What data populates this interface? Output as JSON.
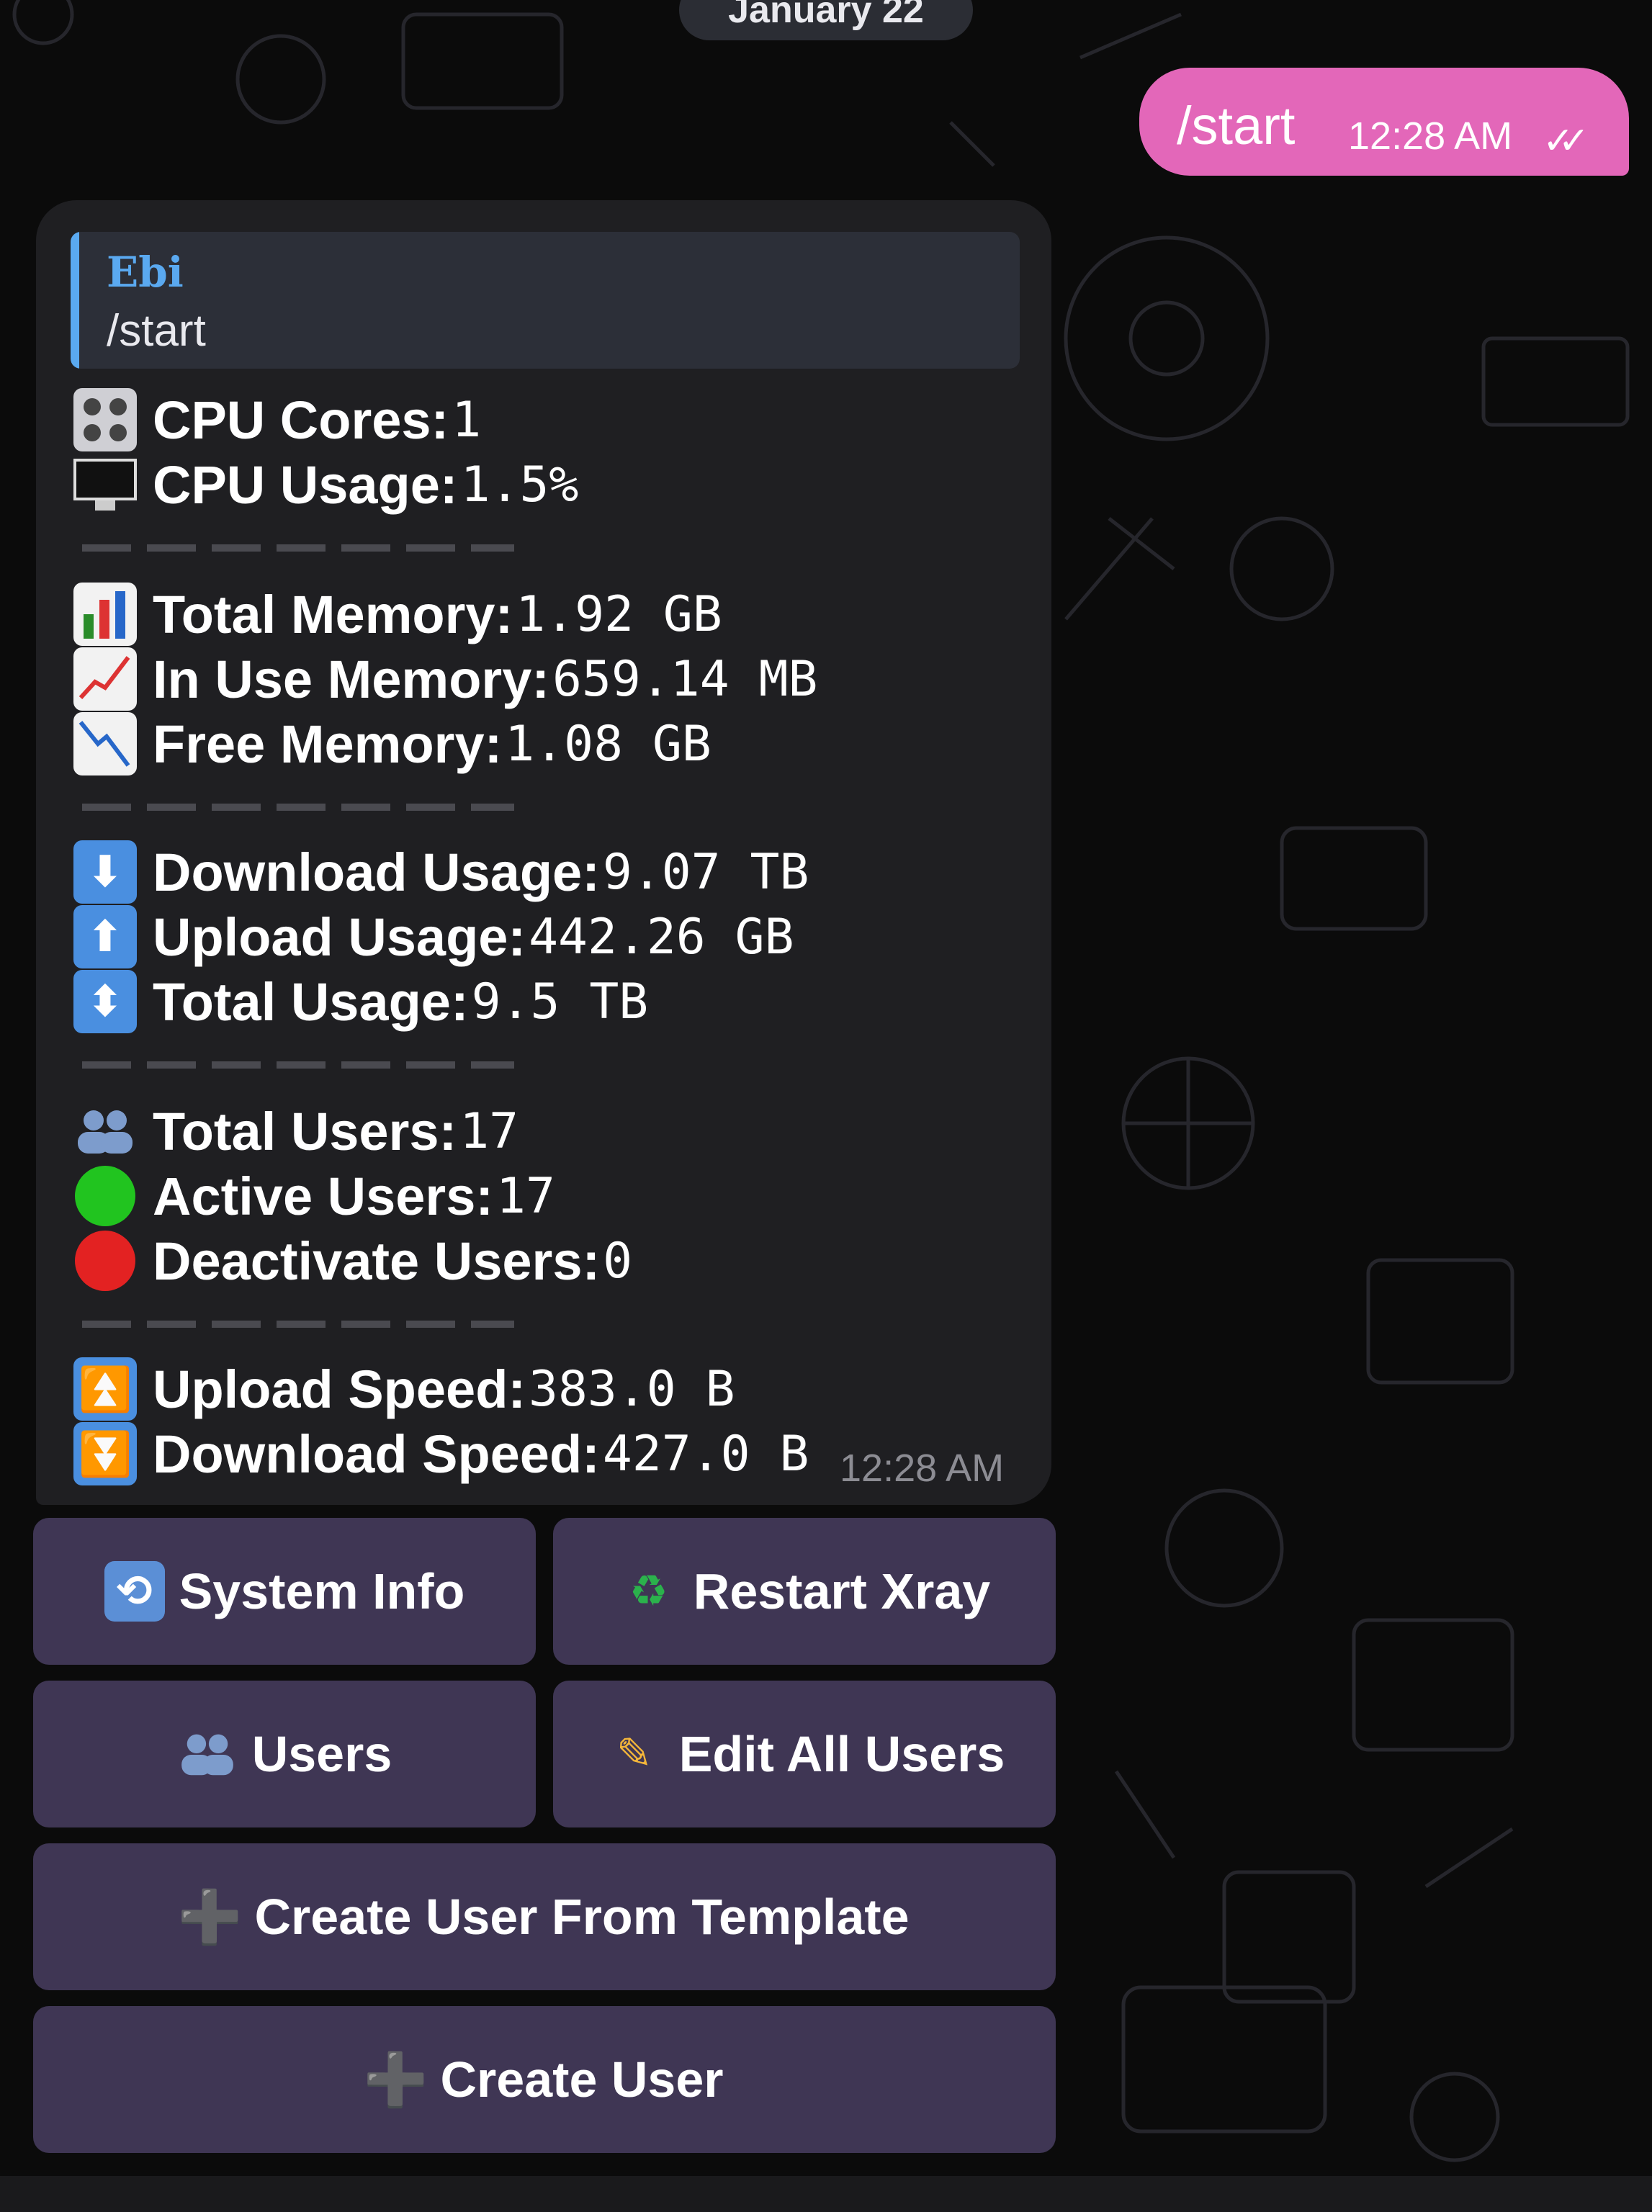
{
  "date_pill": "January 22",
  "outgoing": {
    "text": "/start",
    "time": "12:28 AM",
    "ticks": "✓✓"
  },
  "incoming": {
    "reply": {
      "name": "Ebi",
      "text": "/start"
    },
    "time": "12:28 AM",
    "stats": {
      "cpu_cores": {
        "label": "CPU Cores:",
        "value": "1"
      },
      "cpu_usage": {
        "label": "CPU Usage:",
        "value": "1.5%"
      },
      "total_mem": {
        "label": "Total Memory:",
        "value": "1.92 GB"
      },
      "inuse_mem": {
        "label": "In Use Memory:",
        "value": "659.14 MB"
      },
      "free_mem": {
        "label": "Free Memory:",
        "value": "1.08 GB"
      },
      "dl_usage": {
        "label": "Download Usage:",
        "value": "9.07 TB"
      },
      "ul_usage": {
        "label": "Upload Usage:",
        "value": "442.26 GB"
      },
      "total_usage": {
        "label": "Total Usage:",
        "value": "9.5 TB"
      },
      "total_users": {
        "label": "Total Users:",
        "value": "17"
      },
      "active_users": {
        "label": "Active Users:",
        "value": "17"
      },
      "deact_users": {
        "label": "Deactivate Users:",
        "value": "0"
      },
      "ul_speed": {
        "label": "Upload Speed:",
        "value": "383.0 B"
      },
      "dl_speed": {
        "label": "Download Speed:",
        "value": "427.0 B"
      }
    }
  },
  "buttons": {
    "system_info": "System Info",
    "restart_xray": "Restart Xray",
    "users": "Users",
    "edit_all_users": "Edit All Users",
    "create_from_template": "Create User From Template",
    "create_user": "Create User"
  },
  "colors": {
    "outgoing_bubble": "#e367b9",
    "incoming_bubble": "#1f1f22",
    "reply_accent": "#5aa9f0",
    "button_bg": "#3f3654"
  }
}
